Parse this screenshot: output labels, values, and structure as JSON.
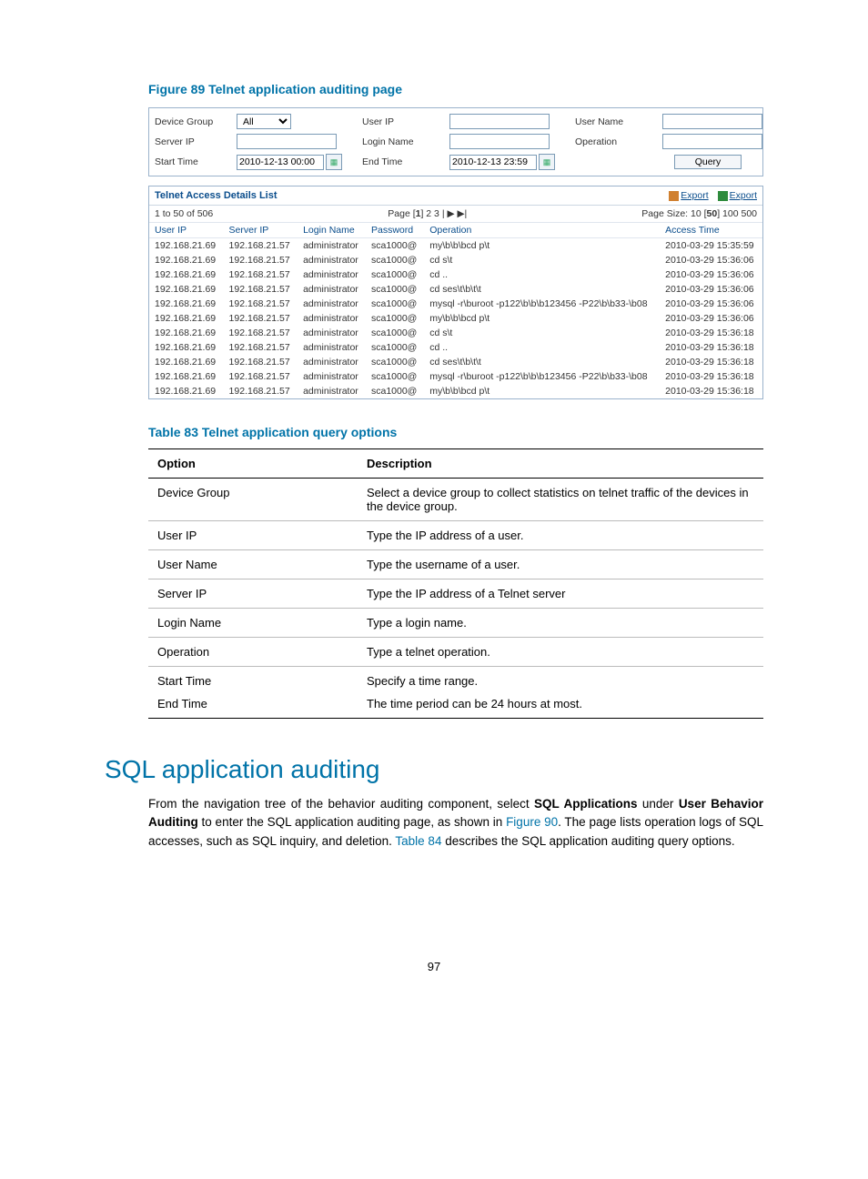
{
  "figure": {
    "caption": "Figure 89 Telnet application auditing page"
  },
  "filters": {
    "device_group_label": "Device Group",
    "device_group_value": "All",
    "user_ip_label": "User IP",
    "user_name_label": "User Name",
    "server_ip_label": "Server IP",
    "login_name_label": "Login Name",
    "operation_label": "Operation",
    "start_time_label": "Start Time",
    "start_time_value": "2010-12-13 00:00",
    "end_time_label": "End Time",
    "end_time_value": "2010-12-13 23:59",
    "query_label": "Query"
  },
  "list": {
    "title": "Telnet Access Details List",
    "export1": "Export",
    "export2": "Export",
    "range": "1 to 50 of 506",
    "page_label_prefix": "Page [",
    "page_current": "1",
    "page_label_suffix": "] 2 3 | ▶ ▶|",
    "page_size_prefix": "Page Size: 10 [",
    "page_size_current": "50",
    "page_size_suffix": "] 100 500",
    "headers": {
      "user_ip": "User IP",
      "server_ip": "Server IP",
      "login_name": "Login Name",
      "password": "Password",
      "operation": "Operation",
      "access_time": "Access Time"
    },
    "rows": [
      {
        "user_ip": "192.168.21.69",
        "server_ip": "192.168.21.57",
        "login_name": "administrator",
        "password": "sca1000@",
        "operation": "my\\b\\b\\bcd p\\t",
        "access_time": "2010-03-29 15:35:59"
      },
      {
        "user_ip": "192.168.21.69",
        "server_ip": "192.168.21.57",
        "login_name": "administrator",
        "password": "sca1000@",
        "operation": "cd s\\t",
        "access_time": "2010-03-29 15:36:06"
      },
      {
        "user_ip": "192.168.21.69",
        "server_ip": "192.168.21.57",
        "login_name": "administrator",
        "password": "sca1000@",
        "operation": "cd ..",
        "access_time": "2010-03-29 15:36:06"
      },
      {
        "user_ip": "192.168.21.69",
        "server_ip": "192.168.21.57",
        "login_name": "administrator",
        "password": "sca1000@",
        "operation": "cd ses\\t\\b\\t\\t",
        "access_time": "2010-03-29 15:36:06"
      },
      {
        "user_ip": "192.168.21.69",
        "server_ip": "192.168.21.57",
        "login_name": "administrator",
        "password": "sca1000@",
        "operation": "mysql -r\\buroot -p122\\b\\b\\b123456 -P22\\b\\b33-\\b08",
        "access_time": "2010-03-29 15:36:06"
      },
      {
        "user_ip": "192.168.21.69",
        "server_ip": "192.168.21.57",
        "login_name": "administrator",
        "password": "sca1000@",
        "operation": "my\\b\\b\\bcd p\\t",
        "access_time": "2010-03-29 15:36:06"
      },
      {
        "user_ip": "192.168.21.69",
        "server_ip": "192.168.21.57",
        "login_name": "administrator",
        "password": "sca1000@",
        "operation": "cd s\\t",
        "access_time": "2010-03-29 15:36:18"
      },
      {
        "user_ip": "192.168.21.69",
        "server_ip": "192.168.21.57",
        "login_name": "administrator",
        "password": "sca1000@",
        "operation": "cd ..",
        "access_time": "2010-03-29 15:36:18"
      },
      {
        "user_ip": "192.168.21.69",
        "server_ip": "192.168.21.57",
        "login_name": "administrator",
        "password": "sca1000@",
        "operation": "cd ses\\t\\b\\t\\t",
        "access_time": "2010-03-29 15:36:18"
      },
      {
        "user_ip": "192.168.21.69",
        "server_ip": "192.168.21.57",
        "login_name": "administrator",
        "password": "sca1000@",
        "operation": "mysql -r\\buroot -p122\\b\\b\\b123456 -P22\\b\\b33-\\b08",
        "access_time": "2010-03-29 15:36:18"
      },
      {
        "user_ip": "192.168.21.69",
        "server_ip": "192.168.21.57",
        "login_name": "administrator",
        "password": "sca1000@",
        "operation": "my\\b\\b\\bcd p\\t",
        "access_time": "2010-03-29 15:36:18"
      }
    ]
  },
  "table83": {
    "caption": "Table 83 Telnet application query options",
    "head_option": "Option",
    "head_desc": "Description",
    "rows": [
      {
        "opt": "Device Group",
        "desc": "Select a device group to collect statistics on telnet traffic of the devices in the device group."
      },
      {
        "opt": "User IP",
        "desc": "Type the IP address of a user."
      },
      {
        "opt": "User Name",
        "desc": "Type the username of a user."
      },
      {
        "opt": "Server IP",
        "desc": "Type the IP address of a Telnet server"
      },
      {
        "opt": "Login Name",
        "desc": "Type a login name."
      },
      {
        "opt": "Operation",
        "desc": "Type a telnet operation."
      }
    ],
    "time_row": {
      "opt1": "Start Time",
      "opt2": "End Time",
      "desc1": "Specify a time range.",
      "desc2": "The time period can be 24 hours at most."
    }
  },
  "section": {
    "heading": "SQL application auditing",
    "p1_a": "From the navigation tree of the behavior auditing component, select ",
    "p1_b": "SQL Applications",
    "p1_c": " under ",
    "p1_d": "User Behavior Auditing",
    "p1_e": " to enter the SQL application auditing page, as shown in ",
    "link1": "Figure 90",
    "p1_f": ". The page lists operation logs of SQL accesses, such as SQL inquiry, and deletion. ",
    "link2": "Table 84",
    "p1_g": " describes the SQL application auditing query options."
  },
  "page_number": "97"
}
